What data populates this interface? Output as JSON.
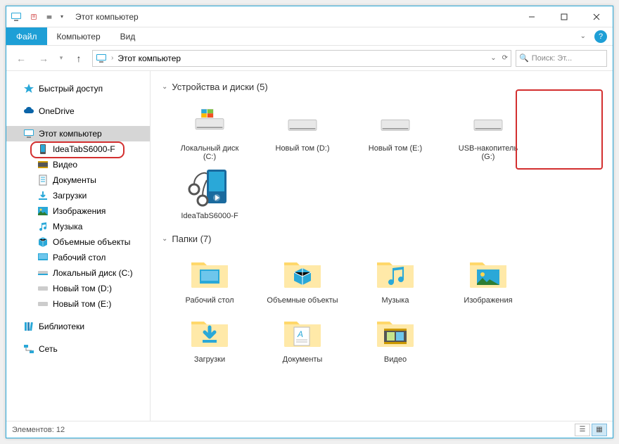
{
  "title": "Этот компьютер",
  "tabs": {
    "file": "Файл",
    "computer": "Компьютер",
    "view": "Вид"
  },
  "address": {
    "text": "Этот компьютер"
  },
  "search": {
    "placeholder": "Поиск: Эт..."
  },
  "sidebar": {
    "quick": "Быстрый доступ",
    "onedrive": "OneDrive",
    "thispc": "Этот компьютер",
    "device": "IdeaTabS6000-F",
    "video": "Видео",
    "docs": "Документы",
    "downloads": "Загрузки",
    "pictures": "Изображения",
    "music": "Музыка",
    "objects": "Объемные объекты",
    "desktop": "Рабочий стол",
    "localc": "Локальный диск (C:)",
    "newd": "Новый том (D:)",
    "newe": "Новый том (E:)",
    "libraries": "Библиотеки",
    "network": "Сеть"
  },
  "sections": {
    "devices": {
      "title": "Устройства и диски (5)",
      "items": [
        "Локальный диск (C:)",
        "Новый том (D:)",
        "Новый том (E:)",
        "USB-накопитель (G:)",
        "IdeaTabS6000-F"
      ]
    },
    "folders": {
      "title": "Папки (7)",
      "items": [
        "Рабочий стол",
        "Объемные объекты",
        "Музыка",
        "Изображения",
        "Загрузки",
        "Документы",
        "Видео"
      ]
    }
  },
  "status": {
    "items": "Элементов: 12"
  }
}
